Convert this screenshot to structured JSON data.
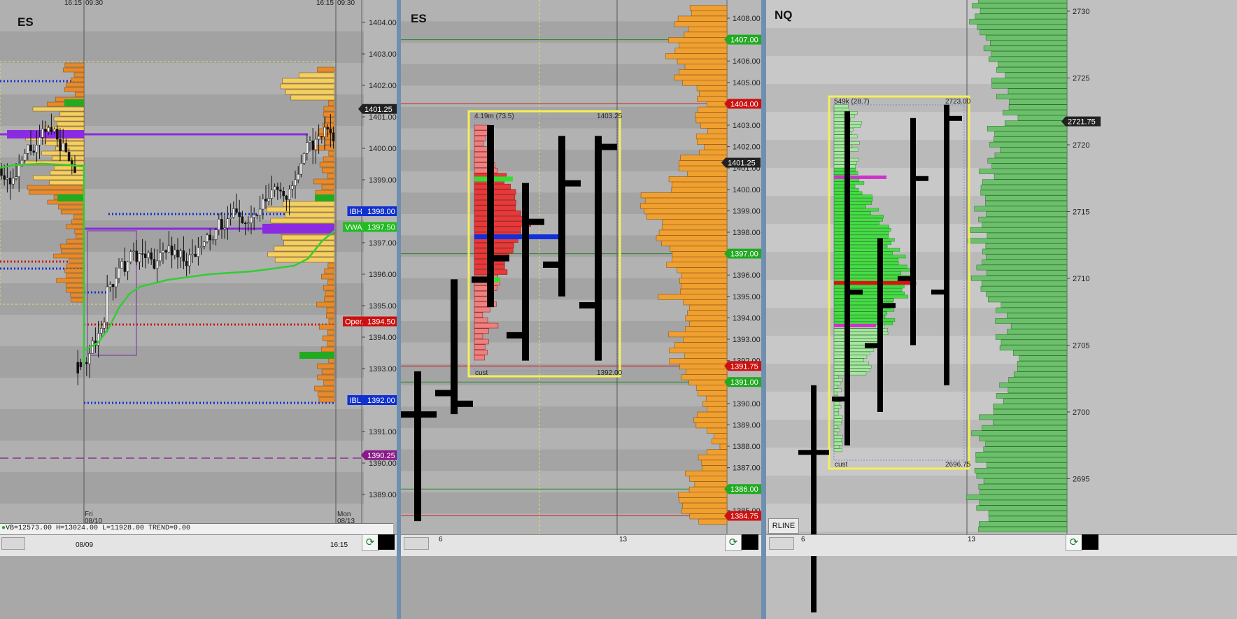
{
  "colors": {
    "up_candle": "#f2f2f2",
    "down_candle": "#111111",
    "vwap": "#33cc33",
    "poc": "#8a2be2",
    "vwap_label_bg": "#22bb22",
    "ibh_color": "#1030d0",
    "open_color": "#cc1111",
    "profile_orange": "#f0a030",
    "profile_green": "#55aa44",
    "value_area_red": "#e83838",
    "value_area_green": "#33dd33",
    "selection_box": "#f4ef5a"
  },
  "panel1": {
    "symbol": "ES",
    "top_times": [
      "16:15",
      "09:30",
      "16:15",
      "09:30"
    ],
    "tags": {
      "ibh_label": "IBH",
      "ibh_price": "1398.00",
      "vwap_label": "VWAP",
      "vwap_price": "1397.50",
      "open_label": "Open",
      "open_price": "1394.50",
      "ibl_label": "IBL",
      "ibl_price": "1392.00",
      "last_price": "1401.25",
      "purple_price": "1390.25"
    },
    "axis_ticks": [
      "1404.00",
      "1403.00",
      "1402.00",
      "1401.00",
      "1400.00",
      "1399.00",
      "1398.00",
      "1397.00",
      "1396.00",
      "1395.00",
      "1394.00",
      "1393.00",
      "1392.00",
      "1391.00",
      "1390.00",
      "1389.00"
    ],
    "x_labels": {
      "fri_day": "Fri",
      "fri_date": "08/10",
      "mon_day": "Mon",
      "mon_date": "08/13"
    },
    "status": "VB=12573.00 H=13024.00 L=11928.00 TREND=0.00",
    "bottom_date": "08/09",
    "bottom_time": "16:15"
  },
  "panel2": {
    "symbol": "ES",
    "box": {
      "top_left": "4.19m (73.5)",
      "top_right": "1403.25",
      "bottom_left": "cust",
      "bottom_right": "1392.00"
    },
    "tags": {
      "p1407": "1407.00",
      "p1404": "1404.00",
      "last": "1401.25",
      "p1397": "1397.00",
      "p1391_75": "1391.75",
      "p1391": "1391.00",
      "p1386": "1386.00",
      "p1384_75": "1384.75"
    },
    "axis_ticks": [
      "1408.00",
      "1407.00",
      "1406.00",
      "1405.00",
      "1404.00",
      "1403.00",
      "1402.00",
      "1401.00",
      "1400.00",
      "1399.00",
      "1398.00",
      "1397.00",
      "1396.00",
      "1395.00",
      "1394.00",
      "1393.00",
      "1392.00",
      "1391.00",
      "1390.00",
      "1389.00",
      "1388.00",
      "1387.00",
      "1386.00",
      "1385.00"
    ],
    "x_labels": [
      "6",
      "13"
    ]
  },
  "panel3": {
    "symbol": "NQ",
    "box": {
      "top_left": "549k (28.7)",
      "top_right": "2723.00",
      "bottom_left": "cust",
      "bottom_right": "2696.75"
    },
    "last": "2721.75",
    "axis_ticks": [
      "2730",
      "2725",
      "2720",
      "2715",
      "2710",
      "2705",
      "2700",
      "2695"
    ],
    "x_labels": [
      "6",
      "13"
    ],
    "rline_button": "RLINE"
  }
}
